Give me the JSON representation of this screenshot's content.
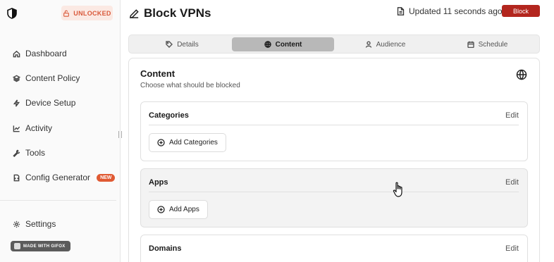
{
  "sidebar": {
    "badge": {
      "label": "UNLOCKED",
      "icon": "lock-open-icon",
      "color": "#d9593a"
    },
    "items": [
      {
        "label": "Dashboard",
        "icon": "home-icon"
      },
      {
        "label": "Content Policy",
        "icon": "layers-icon"
      },
      {
        "label": "Device Setup",
        "icon": "bolt-icon"
      },
      {
        "label": "Activity",
        "icon": "chart-line-icon"
      },
      {
        "label": "Tools",
        "icon": "wrench-icon"
      },
      {
        "label": "Config Generator",
        "icon": "file-code-icon",
        "badge": "NEW"
      }
    ],
    "settings_label": "Settings",
    "made_with": "MADE WITH GIFOX"
  },
  "header": {
    "title": "Block VPNs",
    "updated": "Updated 11 seconds ago",
    "block_button": "Block"
  },
  "tabs": [
    {
      "label": "Details",
      "icon": "tag-icon",
      "active": false
    },
    {
      "label": "Content",
      "icon": "globe-icon",
      "active": true
    },
    {
      "label": "Audience",
      "icon": "user-icon",
      "active": false
    },
    {
      "label": "Schedule",
      "icon": "calendar-icon",
      "active": false
    }
  ],
  "content": {
    "title": "Content",
    "subtitle": "Choose what should be blocked",
    "sections": [
      {
        "title": "Categories",
        "edit": "Edit",
        "add_label": "Add Categories"
      },
      {
        "title": "Apps",
        "edit": "Edit",
        "add_label": "Add Apps"
      },
      {
        "title": "Domains",
        "edit": "Edit"
      }
    ]
  },
  "colors": {
    "accent": "#b3261e",
    "new_badge": "#e05a33"
  }
}
